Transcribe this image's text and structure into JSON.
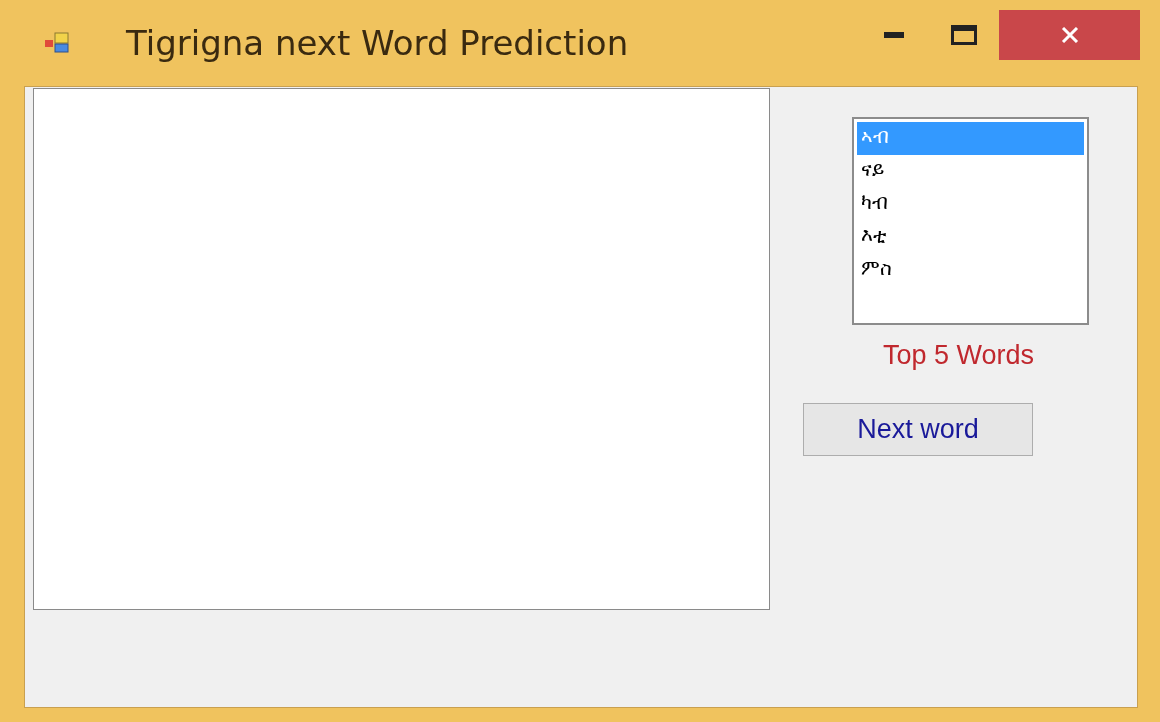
{
  "window": {
    "title": "Tigrigna next Word Prediction"
  },
  "word_list": {
    "items": [
      {
        "label": "ኣብ",
        "selected": true
      },
      {
        "label": "ናይ",
        "selected": false
      },
      {
        "label": "ካብ",
        "selected": false
      },
      {
        "label": "እቲ",
        "selected": false
      },
      {
        "label": "ምስ",
        "selected": false
      }
    ]
  },
  "list_caption": "Top 5 Words",
  "buttons": [
    {
      "label": "Next word"
    }
  ]
}
